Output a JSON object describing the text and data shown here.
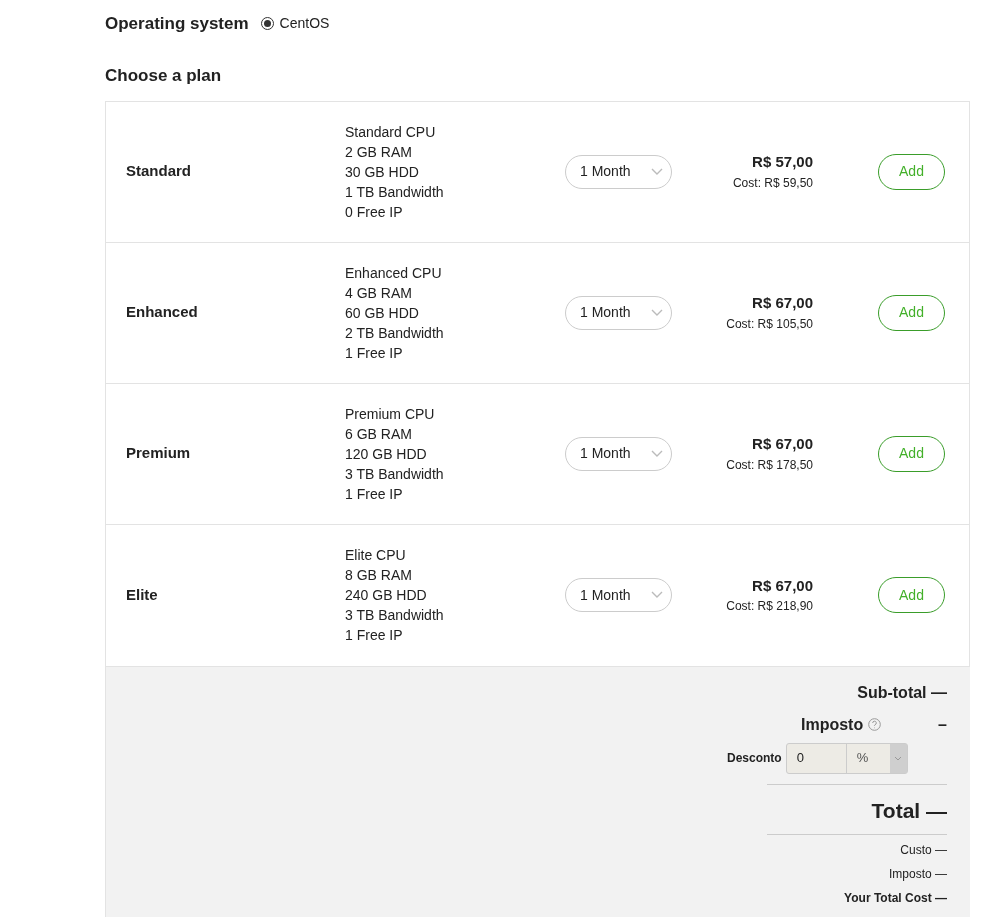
{
  "os": {
    "label": "Operating system",
    "options": [
      {
        "label": "CentOS",
        "selected": true
      }
    ]
  },
  "plans_title": "Choose a plan",
  "plans": [
    {
      "name": "Standard",
      "specs": [
        "Standard CPU",
        "2 GB RAM",
        "30 GB HDD",
        "1 TB Bandwidth",
        "0 Free IP"
      ],
      "period": "1 Month",
      "price": "R$ 57,00",
      "cost": "Cost: R$ 59,50",
      "button": "Add"
    },
    {
      "name": "Enhanced",
      "specs": [
        "Enhanced CPU",
        "4 GB RAM",
        "60 GB HDD",
        "2 TB Bandwidth",
        "1 Free IP"
      ],
      "period": "1 Month",
      "price": "R$ 67,00",
      "cost": "Cost: R$ 105,50",
      "button": "Add"
    },
    {
      "name": "Premium",
      "specs": [
        "Premium CPU",
        "6 GB RAM",
        "120 GB HDD",
        "3 TB Bandwidth",
        "1 Free IP"
      ],
      "period": "1 Month",
      "price": "R$ 67,00",
      "cost": "Cost: R$ 178,50",
      "button": "Add"
    },
    {
      "name": "Elite",
      "specs": [
        "Elite CPU",
        "8 GB RAM",
        "240 GB HDD",
        "3 TB Bandwidth",
        "1 Free IP"
      ],
      "period": "1 Month",
      "price": "R$ 67,00",
      "cost": "Cost: R$ 218,90",
      "button": "Add"
    }
  ],
  "summary": {
    "subtotal": "Sub-total —",
    "tax_label": "Imposto",
    "tax_value": "–",
    "discount_label": "Desconto",
    "discount_value": "0",
    "discount_unit": "%",
    "total": "Total —",
    "lines": [
      "Custo —",
      "Imposto —",
      "Your Total Cost —"
    ]
  }
}
